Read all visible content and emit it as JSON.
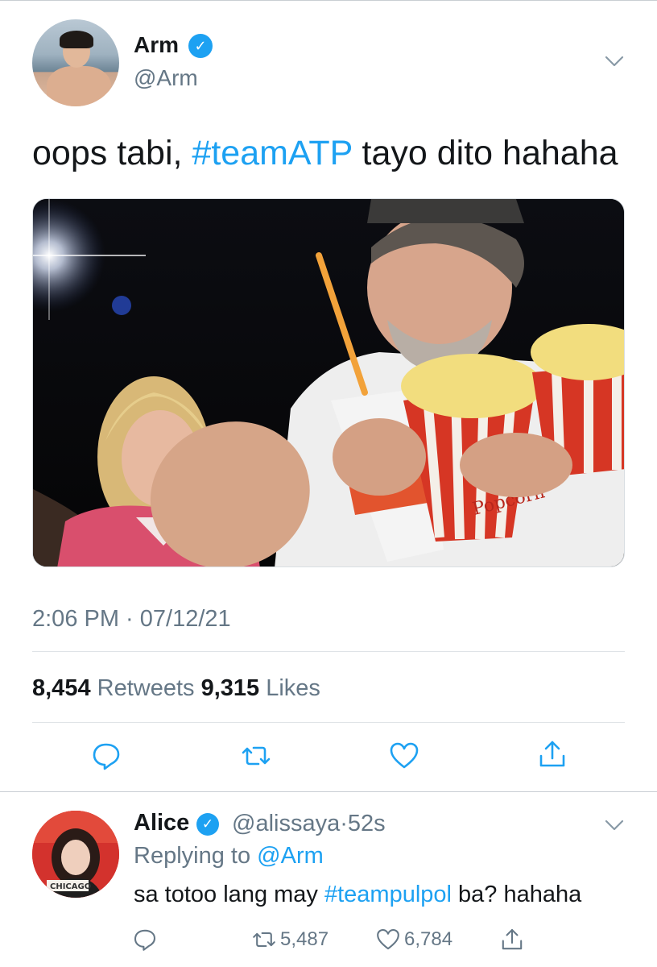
{
  "tweet": {
    "author_name": "Arm",
    "author_handle": "@Arm",
    "text_before": "oops tabi, ",
    "hashtag": "#teamATP",
    "text_after": " tayo dito hahaha",
    "timestamp": "2:06 PM · 07/12/21",
    "retweets_count": "8,454",
    "retweets_label": "Retweets",
    "likes_count": "9,315",
    "likes_label": "Likes",
    "image_overlay_text": "Popcorn",
    "icons": [
      "verified-badge-icon",
      "chevron-down-icon",
      "reply-icon",
      "retweet-icon",
      "like-icon",
      "share-icon"
    ]
  },
  "reply": {
    "author_name": "Alice",
    "author_handle": "@alissaya",
    "separator": "·",
    "time_ago": "52s",
    "replying_to_label": "Replying to",
    "replying_to_handle": "@Arm",
    "text_before": "sa totoo lang may ",
    "hashtag": "#teampulpol",
    "text_after": " ba? hahaha",
    "retweets": "5,487",
    "likes": "6,784",
    "avatar_text": "CHICAGO"
  },
  "colors": {
    "accent": "#1da1f2",
    "secondary_text": "#657786",
    "primary_text": "#14171a"
  }
}
